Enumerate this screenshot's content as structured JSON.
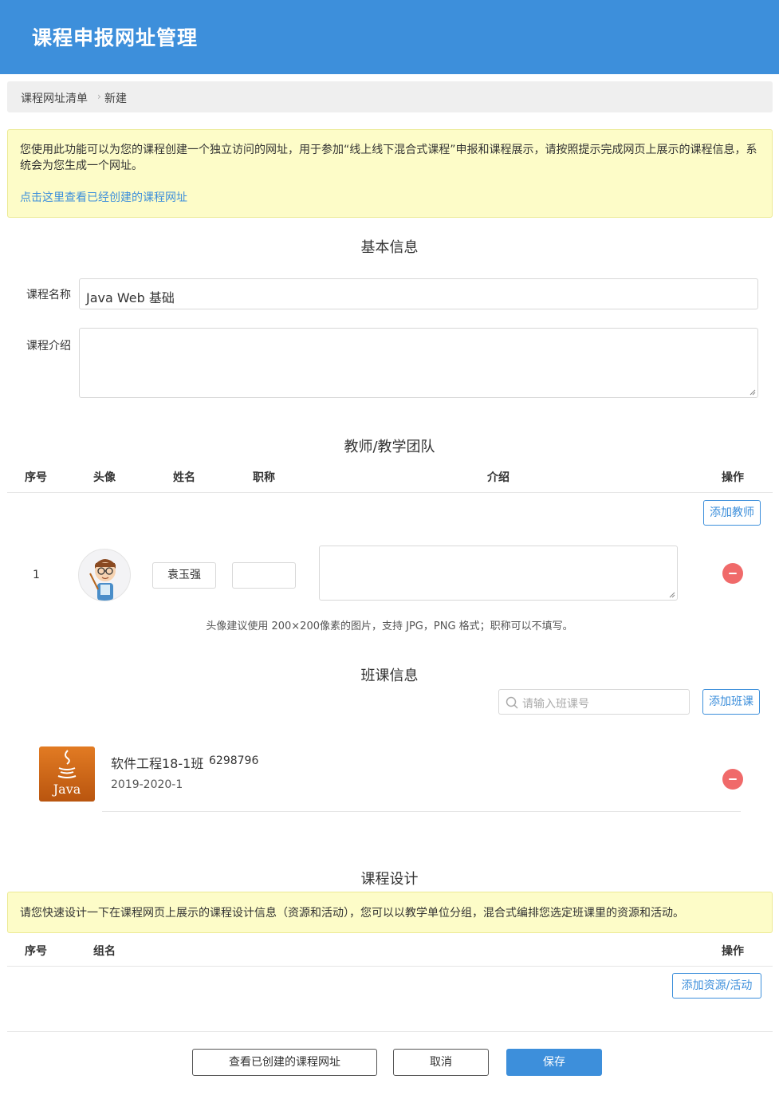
{
  "header": {
    "title": "课程申报网址管理"
  },
  "breadcrumb": {
    "items": [
      "课程网址清单",
      "新建"
    ],
    "separator": "›"
  },
  "intro_notice": {
    "text": "您使用此功能可以为您的课程创建一个独立访问的网址，用于参加“线上线下混合式课程”申报和课程展示，请按照提示完成网页上展示的课程信息，系统会为您生成一个网址。",
    "link": "点击这里查看已经创建的课程网址"
  },
  "basic_info": {
    "title": "基本信息",
    "course_name_label": "课程名称",
    "course_name_value": "Java Web 基础",
    "course_intro_label": "课程介绍",
    "course_intro_value": ""
  },
  "team": {
    "title": "教师/教学团队",
    "columns": [
      "序号",
      "头像",
      "姓名",
      "职称",
      "介绍",
      "操作"
    ],
    "add_button": "添加教师",
    "rows": [
      {
        "index": "1",
        "name": "袁玉强",
        "rank": "",
        "intro": ""
      }
    ],
    "hint": "头像建议使用 200×200像素的图片，支持 JPG，PNG 格式；职称可以不填写。"
  },
  "classes": {
    "title": "班课信息",
    "search_placeholder": "请输入班课号",
    "add_button": "添加班课",
    "items": [
      {
        "name": "软件工程18-1班",
        "code": "6298796",
        "term": "2019-2020-1",
        "logo_text": "Java"
      }
    ]
  },
  "design": {
    "title": "课程设计",
    "notice": "请您快速设计一下在课程网页上展示的课程设计信息（资源和活动），您可以以教学单位分组，混合式编排您选定班课里的资源和活动。",
    "columns": [
      "序号",
      "组名",
      "操作"
    ],
    "add_button": "添加资源/活动"
  },
  "footer": {
    "view_button": "查看已创建的课程网址",
    "cancel_button": "取消",
    "save_button": "保存"
  },
  "colors": {
    "brand": "#3d8fdb",
    "notice_bg": "#fdfcc8",
    "danger": "#f06a6a"
  }
}
